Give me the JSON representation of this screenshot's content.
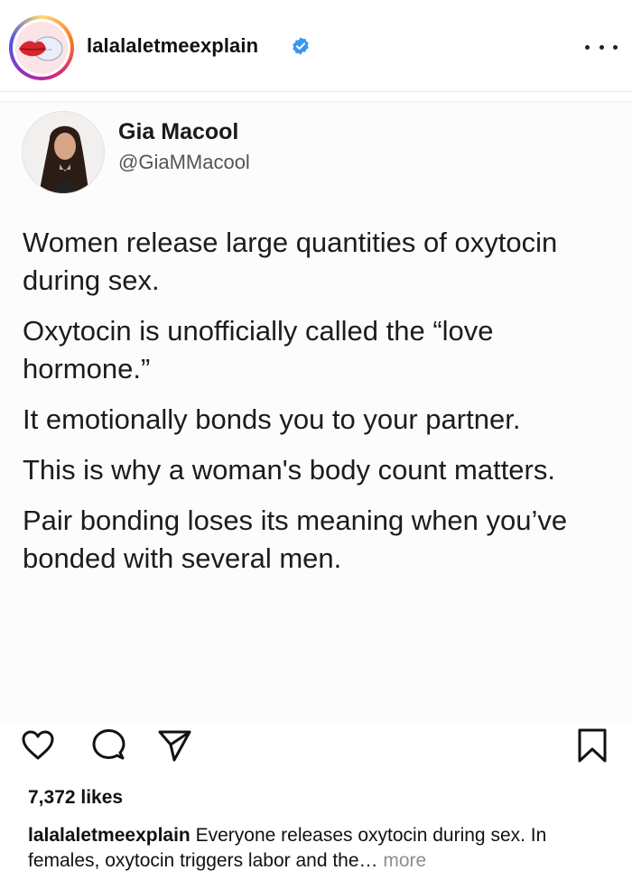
{
  "post": {
    "username": "lalalaletmeexplain",
    "verified": true
  },
  "tweet": {
    "name": "Gia Macool",
    "handle": "@GiaMMacool",
    "paragraphs": [
      "Women release large quantities of oxytocin during sex.",
      "Oxytocin is unofficially called the “love hormone.”",
      "It emotionally bonds you to your partner.",
      "This is why a woman's body count matters.",
      "Pair bonding loses its meaning when you’ve bonded with several men."
    ]
  },
  "actions": {
    "like_icon": "heart-icon",
    "comment_icon": "comment-icon",
    "share_icon": "share-icon",
    "save_icon": "bookmark-icon"
  },
  "likes": "7,372 likes",
  "caption": {
    "user": "lalalaletmeexplain",
    "text": " Everyone releases oxytocin during sex. In females, oxytocin triggers labor and the… ",
    "more": "more"
  },
  "colors": {
    "verified": "#3897f0",
    "muted": "#8e8e8e"
  }
}
